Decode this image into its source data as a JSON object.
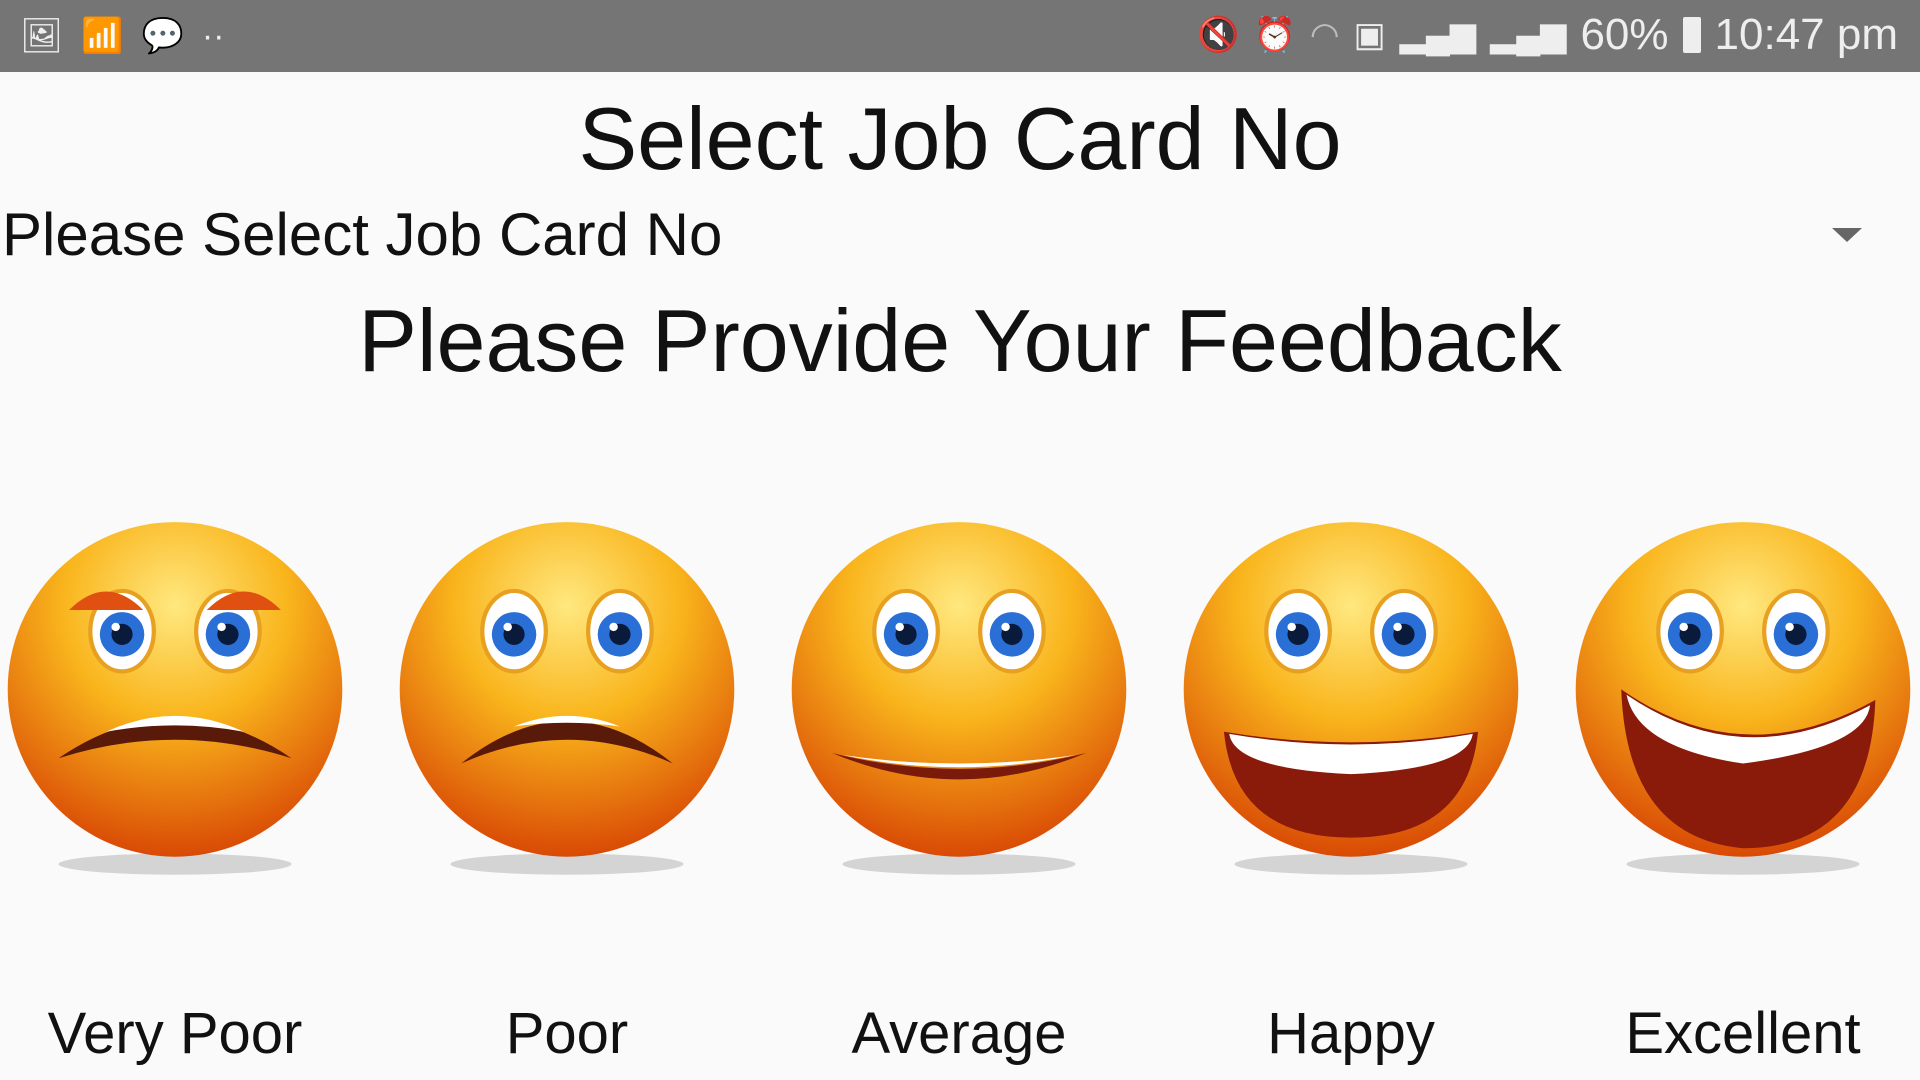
{
  "status_bar": {
    "icons_left": [
      "gallery-icon",
      "wifi-secure-icon",
      "messenger-icon",
      "more-dots-icon"
    ],
    "icons_right": [
      "mute-icon",
      "alarm-icon",
      "wifi-icon",
      "sim-icon",
      "signal-icon",
      "signal-icon"
    ],
    "battery": "60%",
    "time": "10:47 pm",
    "dots": "··"
  },
  "header": {
    "title": "Select Job Card No"
  },
  "spinner": {
    "value": "Please Select Job Card No"
  },
  "feedback": {
    "title": "Please Provide Your Feedback",
    "options": [
      {
        "label": "Very Poor",
        "mood": "very-poor"
      },
      {
        "label": "Poor",
        "mood": "poor"
      },
      {
        "label": "Average",
        "mood": "average"
      },
      {
        "label": "Happy",
        "mood": "happy"
      },
      {
        "label": "Excellent",
        "mood": "excellent"
      }
    ]
  },
  "colors": {
    "status_bar": "#757575",
    "face": "#f7a21b"
  }
}
